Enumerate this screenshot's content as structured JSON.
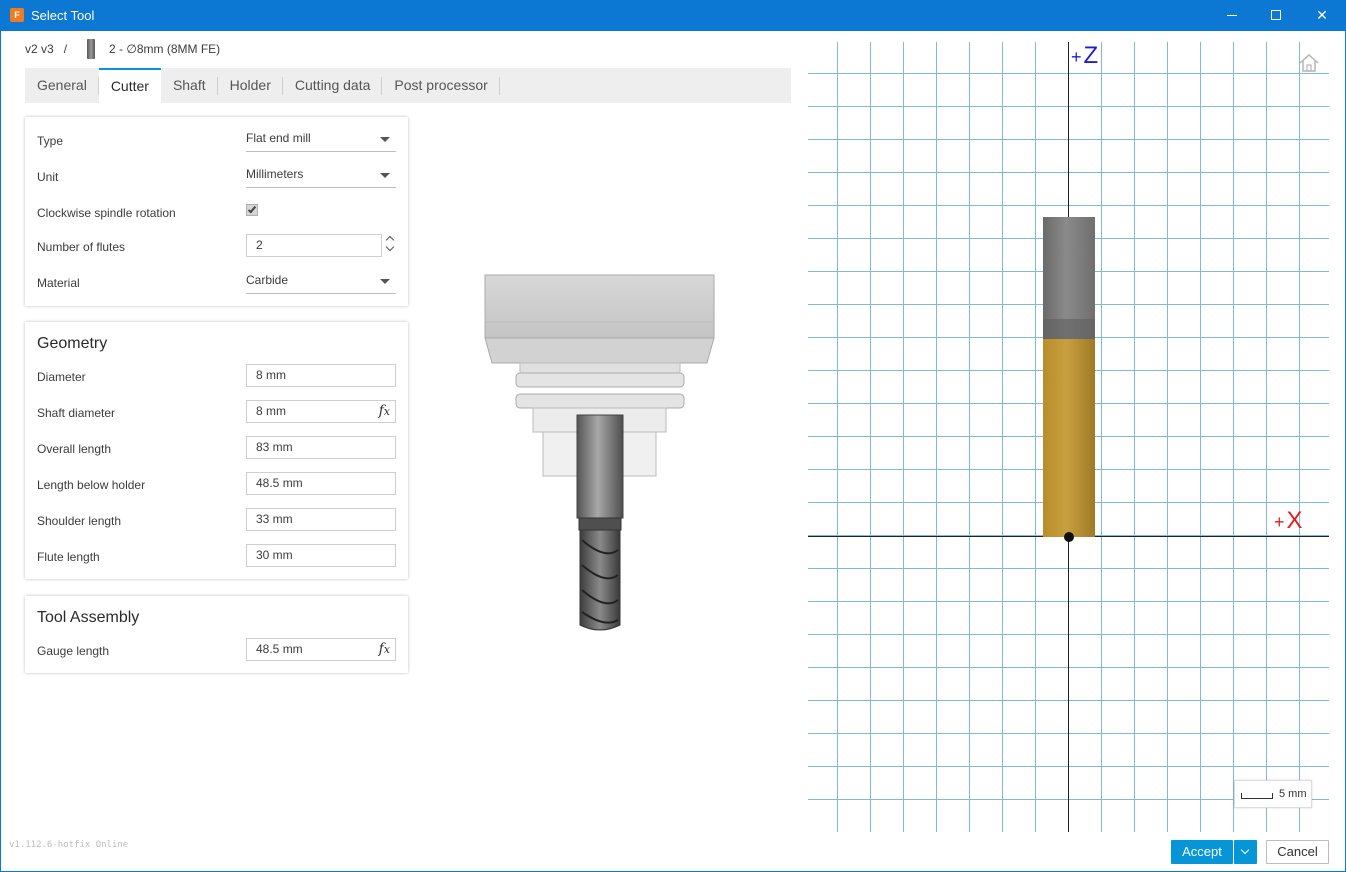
{
  "window": {
    "title": "Select Tool",
    "app_icon_text": "F",
    "minimize_label": "",
    "maximize_label": "",
    "close_label": "✕"
  },
  "breadcrumb": {
    "root": "v2 v3",
    "separator": "/",
    "tool_name": "2 - ∅8mm (8MM FE)"
  },
  "tabs": [
    {
      "label": "General"
    },
    {
      "label": "Cutter",
      "active": true
    },
    {
      "label": "Shaft"
    },
    {
      "label": "Holder"
    },
    {
      "label": "Cutting data"
    },
    {
      "label": "Post processor"
    }
  ],
  "basic": {
    "type_label": "Type",
    "type_value": "Flat end mill",
    "unit_label": "Unit",
    "unit_value": "Millimeters",
    "clockwise_label": "Clockwise spindle rotation",
    "clockwise_checked": true,
    "flutes_label": "Number of flutes",
    "flutes_value": "2",
    "material_label": "Material",
    "material_value": "Carbide"
  },
  "geometry": {
    "heading": "Geometry",
    "diameter_label": "Diameter",
    "diameter_value": "8 mm",
    "shaft_diameter_label": "Shaft diameter",
    "shaft_diameter_value": "8 mm",
    "overall_length_label": "Overall length",
    "overall_length_value": "83 mm",
    "length_below_holder_label": "Length below holder",
    "length_below_holder_value": "48.5 mm",
    "shoulder_length_label": "Shoulder length",
    "shoulder_length_value": "33 mm",
    "flute_length_label": "Flute length",
    "flute_length_value": "30 mm",
    "fx_symbol": "f",
    "fx_sub": "x"
  },
  "assembly": {
    "heading": "Tool Assembly",
    "gauge_length_label": "Gauge length",
    "gauge_length_value": "48.5 mm"
  },
  "viewport": {
    "z_axis_label": "Z",
    "x_axis_label": "X",
    "axis_plus": "+",
    "scale_label": "5 mm",
    "grid_color": "#7fbcd4",
    "cutter_color": "#c9a040",
    "shaft_color": "#7a7a7a"
  },
  "footer": {
    "version": "v1.112.6-hotfix Online",
    "accept_label": "Accept",
    "cancel_label": "Cancel",
    "accent_color": "#0696d7"
  }
}
